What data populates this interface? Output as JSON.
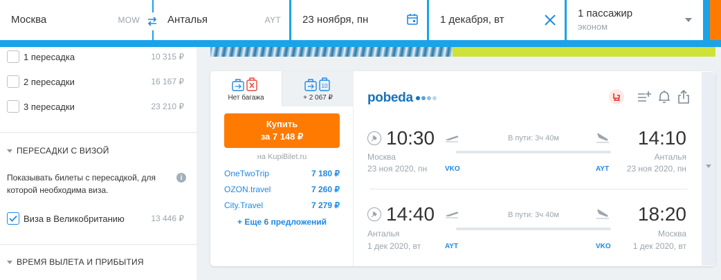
{
  "search": {
    "from_city": "Москва",
    "from_code": "MOW",
    "to_city": "Анталья",
    "to_code": "AYT",
    "depart_date": "23 ноября, пн",
    "return_date": "1 декабря, вт",
    "passengers": "1 пассажир",
    "cabin_class": "эконом",
    "colors": {
      "bar": "#1aa3e8",
      "search_button": "#ff7a00"
    }
  },
  "sidebar": {
    "stops": [
      {
        "label": "1 пересадка",
        "price": "10 315 ₽",
        "checked": false
      },
      {
        "label": "2 пересадки",
        "price": "16 167 ₽",
        "checked": false
      },
      {
        "label": "3 пересадки",
        "price": "23 210 ₽",
        "checked": false
      }
    ],
    "visa_section": {
      "title": "ПЕРЕСАДКИ С ВИЗОЙ",
      "note": "Показывать билеты с пересадкой, для которой необходима виза.",
      "option_label": "Виза в Великобританию",
      "option_price": "13 446 ₽",
      "option_checked": true
    },
    "time_section_title": "ВРЕМЯ ВЫЛЕТА И ПРИБЫТИЯ"
  },
  "ticket": {
    "baggage_tabs": [
      {
        "label": "Нет багажа",
        "icon": "no-baggage-icon",
        "active": true
      },
      {
        "label": "+ 2 067 ₽",
        "icon": "baggage-10kg-icon",
        "badge": "10",
        "active": false
      }
    ],
    "buy_label": "Купить",
    "buy_price": "за 7 148 ₽",
    "buy_source": "на KupiBilet.ru",
    "offers": [
      {
        "agency": "OneTwoTrip",
        "price": "7 180 ₽"
      },
      {
        "agency": "OZON.travel",
        "price": "7 260 ₽"
      },
      {
        "agency": "City.Travel",
        "price": "7 279 ₽"
      }
    ],
    "more_offers": "+ Еще 6 предложений",
    "airline": {
      "name": "pobeda",
      "dot_colors": [
        "#1872b8",
        "#5aa4d8",
        "#8fc2e6",
        "#b9d9ef"
      ]
    },
    "action_icons": [
      "seat-icon",
      "add-to-list-icon",
      "bell-icon",
      "share-icon"
    ],
    "segments": [
      {
        "dep_time": "10:30",
        "arr_time": "14:10",
        "dep_city": "Москва",
        "arr_city": "Анталья",
        "dep_date": "23 ноя 2020, пн",
        "arr_date": "23 ноя 2020, пн",
        "dep_iata": "VKO",
        "arr_iata": "AYT",
        "duration": "В пути: 3ч 40м"
      },
      {
        "dep_time": "14:40",
        "arr_time": "18:20",
        "dep_city": "Анталья",
        "arr_city": "Москва",
        "dep_date": "1 дек 2020, вт",
        "arr_date": "1 дек 2020, вт",
        "dep_iata": "AYT",
        "arr_iata": "VKO",
        "duration": "В пути: 3ч 40м"
      }
    ]
  }
}
